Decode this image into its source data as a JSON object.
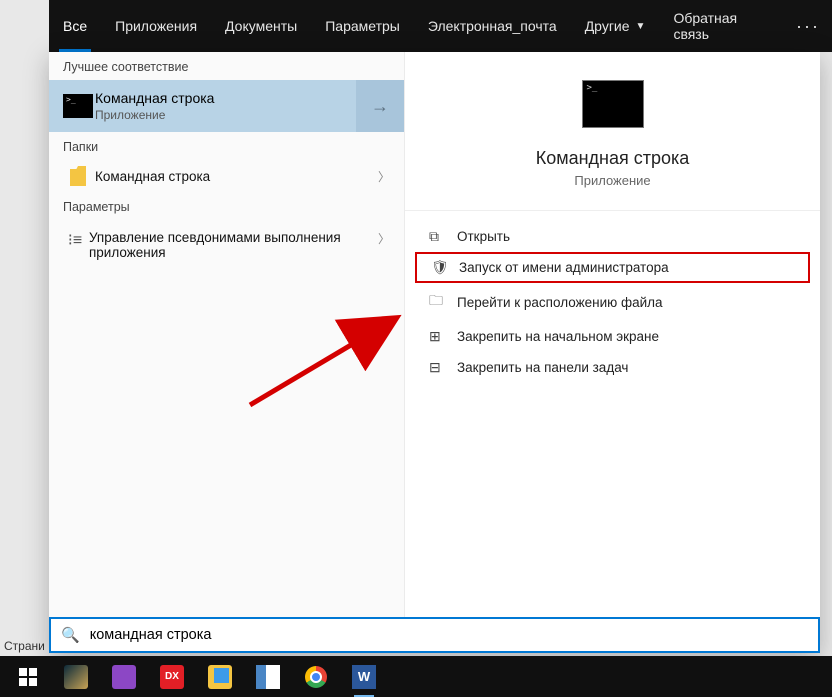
{
  "behind_window_text": "Страни",
  "nav": {
    "tabs": [
      "Все",
      "Приложения",
      "Документы",
      "Параметры",
      "Электронная_почта",
      "Другие"
    ],
    "feedback": "Обратная связь"
  },
  "left": {
    "best_match_head": "Лучшее соответствие",
    "selected": {
      "title": "Командная строка",
      "subtitle": "Приложение"
    },
    "folders_head": "Папки",
    "folder_item": "Командная строка",
    "settings_head": "Параметры",
    "settings_item": "Управление псевдонимами выполнения приложения"
  },
  "preview": {
    "title": "Командная строка",
    "subtitle": "Приложение"
  },
  "actions": {
    "open": "Открыть",
    "run_admin": "Запуск от имени администратора",
    "open_location": "Перейти к расположению файла",
    "pin_start": "Закрепить на начальном экране",
    "pin_taskbar": "Закрепить на панели задач"
  },
  "search": {
    "value": "командная строка"
  },
  "taskbar_dx_label": "DX",
  "taskbar_word_label": "W"
}
